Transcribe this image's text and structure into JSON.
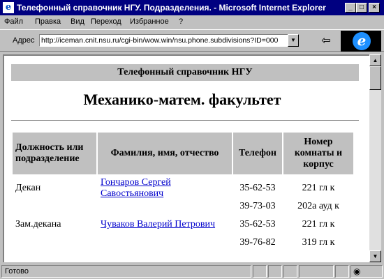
{
  "window": {
    "title": "Телефонный справочник НГУ. Подразделения. - Microsoft Internet Explorer",
    "app_icon": "e",
    "buttons": {
      "minimize": "_",
      "maximize": "□",
      "close": "×"
    }
  },
  "menu": [
    "Файл",
    "Правка",
    "Вид",
    "Переход",
    "Избранное",
    "?"
  ],
  "address": {
    "label": "Адрес",
    "url": "http://iceman.cnit.nsu.ru/cgi-bin/wow.win/nsu.phone.subdivisions?ID=000"
  },
  "page": {
    "header": "Телефонный справочник НГУ",
    "faculty": "Механико-матем. факультет",
    "columns": [
      "Должность или подразделение",
      "Фамилия, имя, отчество",
      "Телефон",
      "Номер комнаты и корпус"
    ],
    "rows": [
      {
        "position": "Декан",
        "name": "Гончаров Сергей Савостьянович",
        "phone": "35-62-53",
        "room": "221 гл к"
      },
      {
        "position": "",
        "name": "",
        "phone": "39-73-03",
        "room": "202а ауд к"
      },
      {
        "position": "Зам.декана",
        "name": "Чуваков Валерий Петрович",
        "phone": "35-62-53",
        "room": "221 гл к"
      },
      {
        "position": "",
        "name": "",
        "phone": "39-76-82",
        "room": "319 гл к"
      }
    ]
  },
  "status": {
    "text": "Готово"
  },
  "icons": [
    "ie-logo-icon",
    "back-arrow-icon",
    "dropdown-arrow-icon",
    "scroll-up-icon",
    "scroll-down-icon",
    "security-zone-icon"
  ]
}
